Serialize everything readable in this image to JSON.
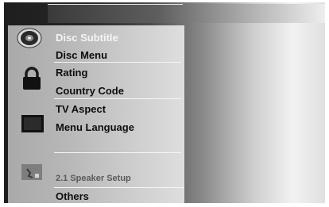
{
  "menu": {
    "items": [
      {
        "label": "Disc Subtitle"
      },
      {
        "label": "Disc Menu"
      },
      {
        "label": "Rating"
      },
      {
        "label": "Country Code"
      },
      {
        "label": "TV Aspect"
      },
      {
        "label": "Menu Language"
      },
      {
        "label": "2.1 Speaker Setup"
      },
      {
        "label": "Others"
      }
    ]
  },
  "icons": [
    "disc-icon",
    "lock-icon",
    "tv-screen-icon",
    "speaker-setup-icon"
  ]
}
